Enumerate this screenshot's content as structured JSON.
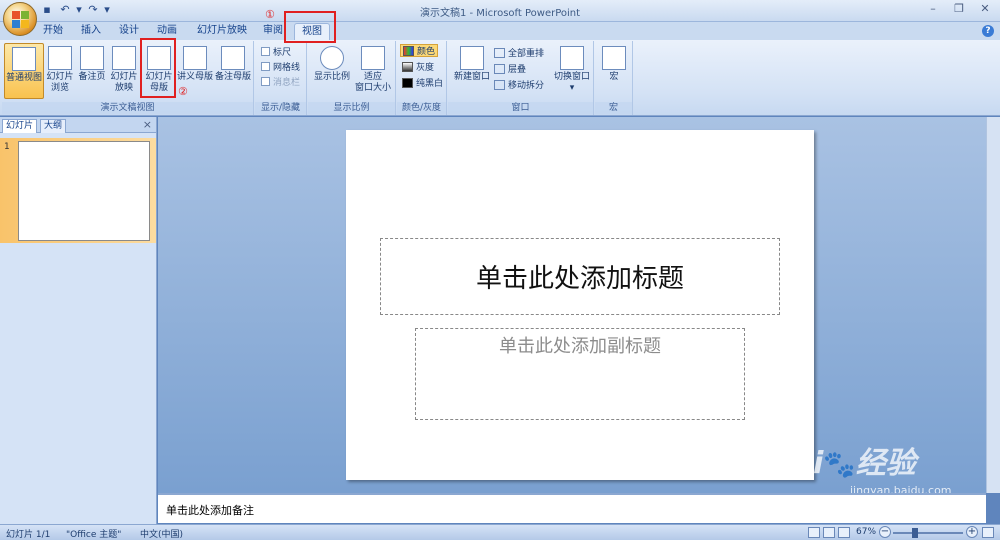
{
  "title_bar": {
    "title": "演示文稿1 - Microsoft PowerPoint"
  },
  "tabs": [
    "开始",
    "插入",
    "设计",
    "动画",
    "幻灯片放映",
    "审阅",
    "视图"
  ],
  "active_tab": "视图",
  "ribbon": {
    "presentation_views": {
      "label": "演示文稿视图",
      "normal": "普通视图",
      "sorter_1": "幻灯片",
      "sorter_2": "浏览",
      "notes_page": "备注页",
      "show_1": "幻灯片",
      "show_2": "放映",
      "master_1": "幻灯片",
      "master_2": "母版",
      "handout_master": "讲义母版",
      "notes_master": "备注母版"
    },
    "show_hide": {
      "label": "显示/隐藏",
      "ruler": "标尺",
      "gridlines": "网格线",
      "message_bar": "消息栏"
    },
    "zoom": {
      "label": "显示比例",
      "zoom": "显示比例",
      "fit_1": "适应",
      "fit_2": "窗口大小"
    },
    "color": {
      "label": "颜色/灰度",
      "color": "颜色",
      "grayscale": "灰度",
      "bw": "纯黑白"
    },
    "window": {
      "label": "窗口",
      "new_window": "新建窗口",
      "arrange_all": "全部重排",
      "cascade": "层叠",
      "move_split": "移动拆分",
      "switch_1": "切换窗口",
      "switch_2": "▾"
    },
    "macros": {
      "label": "宏",
      "macros": "宏"
    }
  },
  "annotations": {
    "mark_1": "①",
    "mark_2": "②"
  },
  "left_panel": {
    "tab_slides": "幻灯片",
    "tab_outline": "大纲",
    "close": "×",
    "slide_number": "1"
  },
  "slide": {
    "title_placeholder": "单击此处添加标题",
    "subtitle_placeholder": "单击此处添加副标题"
  },
  "notes": {
    "placeholder": "单击此处添加备注"
  },
  "status_bar": {
    "slide_info": "幻灯片 1/1",
    "theme": "\"Office 主题\"",
    "language": "中文(中国)",
    "zoom": "67%"
  },
  "watermark": {
    "brand": "Bai",
    "brand2": "经验",
    "url": "jingyan.baidu.com"
  },
  "colors": {
    "accent_red": "#e02020",
    "ribbon_bg": "#d4e2f5",
    "selected": "#f9c24f"
  }
}
